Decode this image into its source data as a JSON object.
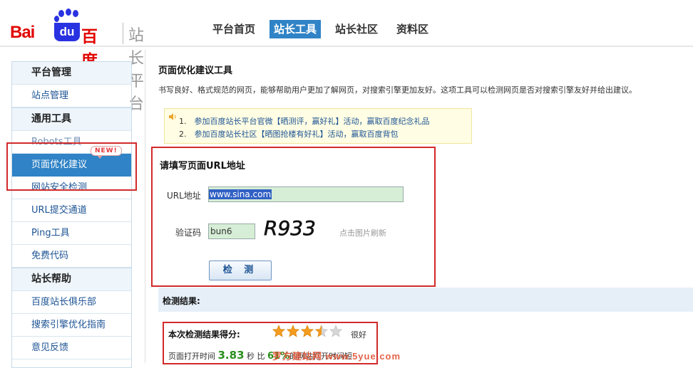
{
  "brand": {
    "bai": "Bai",
    "du": "du",
    "baidu_cn": "百度",
    "platform": "站长平台"
  },
  "nav": [
    {
      "label": "平台首页",
      "active": false
    },
    {
      "label": "站长工具",
      "active": true
    },
    {
      "label": "站长社区",
      "active": false
    },
    {
      "label": "资料区",
      "active": false
    }
  ],
  "sidebar": {
    "items": [
      {
        "label": "平台管理",
        "type": "head"
      },
      {
        "label": "站点管理",
        "type": "item"
      },
      {
        "label": "通用工具",
        "type": "head"
      },
      {
        "label": "Robots工具",
        "type": "muted"
      },
      {
        "label": "页面优化建议",
        "type": "active",
        "badge": "NEW!"
      },
      {
        "label": "网站安全检测",
        "type": "item"
      },
      {
        "label": "URL提交通道",
        "type": "item"
      },
      {
        "label": "Ping工具",
        "type": "item"
      },
      {
        "label": "免费代码",
        "type": "item"
      },
      {
        "label": "站长帮助",
        "type": "head"
      },
      {
        "label": "百度站长俱乐部",
        "type": "item"
      },
      {
        "label": "搜索引擎优化指南",
        "type": "item"
      },
      {
        "label": "意见反馈",
        "type": "item"
      }
    ]
  },
  "main": {
    "title": "页面优化建议工具",
    "description": "书写良好、格式规范的网页，能够帮助用户更加了解网页，对搜索引擎更加友好。这项工具可以检测网页是否对搜索引擎友好并给出建议。",
    "notices": [
      {
        "num": "1.",
        "text": "参加百度站长平台官微【晒测评，赢好礼】活动，赢取百度纪念礼品"
      },
      {
        "num": "2.",
        "text": "参加百度站长社区【晒图抢楼有好礼】活动，赢取百度背包"
      }
    ]
  },
  "form": {
    "title": "请填写页面URL地址",
    "url_label": "URL地址",
    "url_value": "www.sina.com",
    "captcha_label": "验证码",
    "captcha_value": "bun6",
    "captcha_image_text": "R933",
    "refresh_hint": "点击图片刷新",
    "submit_label": "检 测"
  },
  "result": {
    "title": "检测结果:",
    "score_label": "本次检测结果得分:",
    "rating_stars": 3.5,
    "rating_max": 5,
    "rating_word": "很好",
    "time_prefix": "页面打开时间",
    "time_value": "3.83",
    "time_unit": "秒 比",
    "percent_value": "61%",
    "time_suffix": "的网站打开时间短"
  },
  "watermark": "罗方建站网 www.5yue.com",
  "colors": {
    "accent": "#2f83c6",
    "brand_red": "#e10602",
    "brand_blue": "#2932e1",
    "highlight_border": "#d22a2a"
  }
}
